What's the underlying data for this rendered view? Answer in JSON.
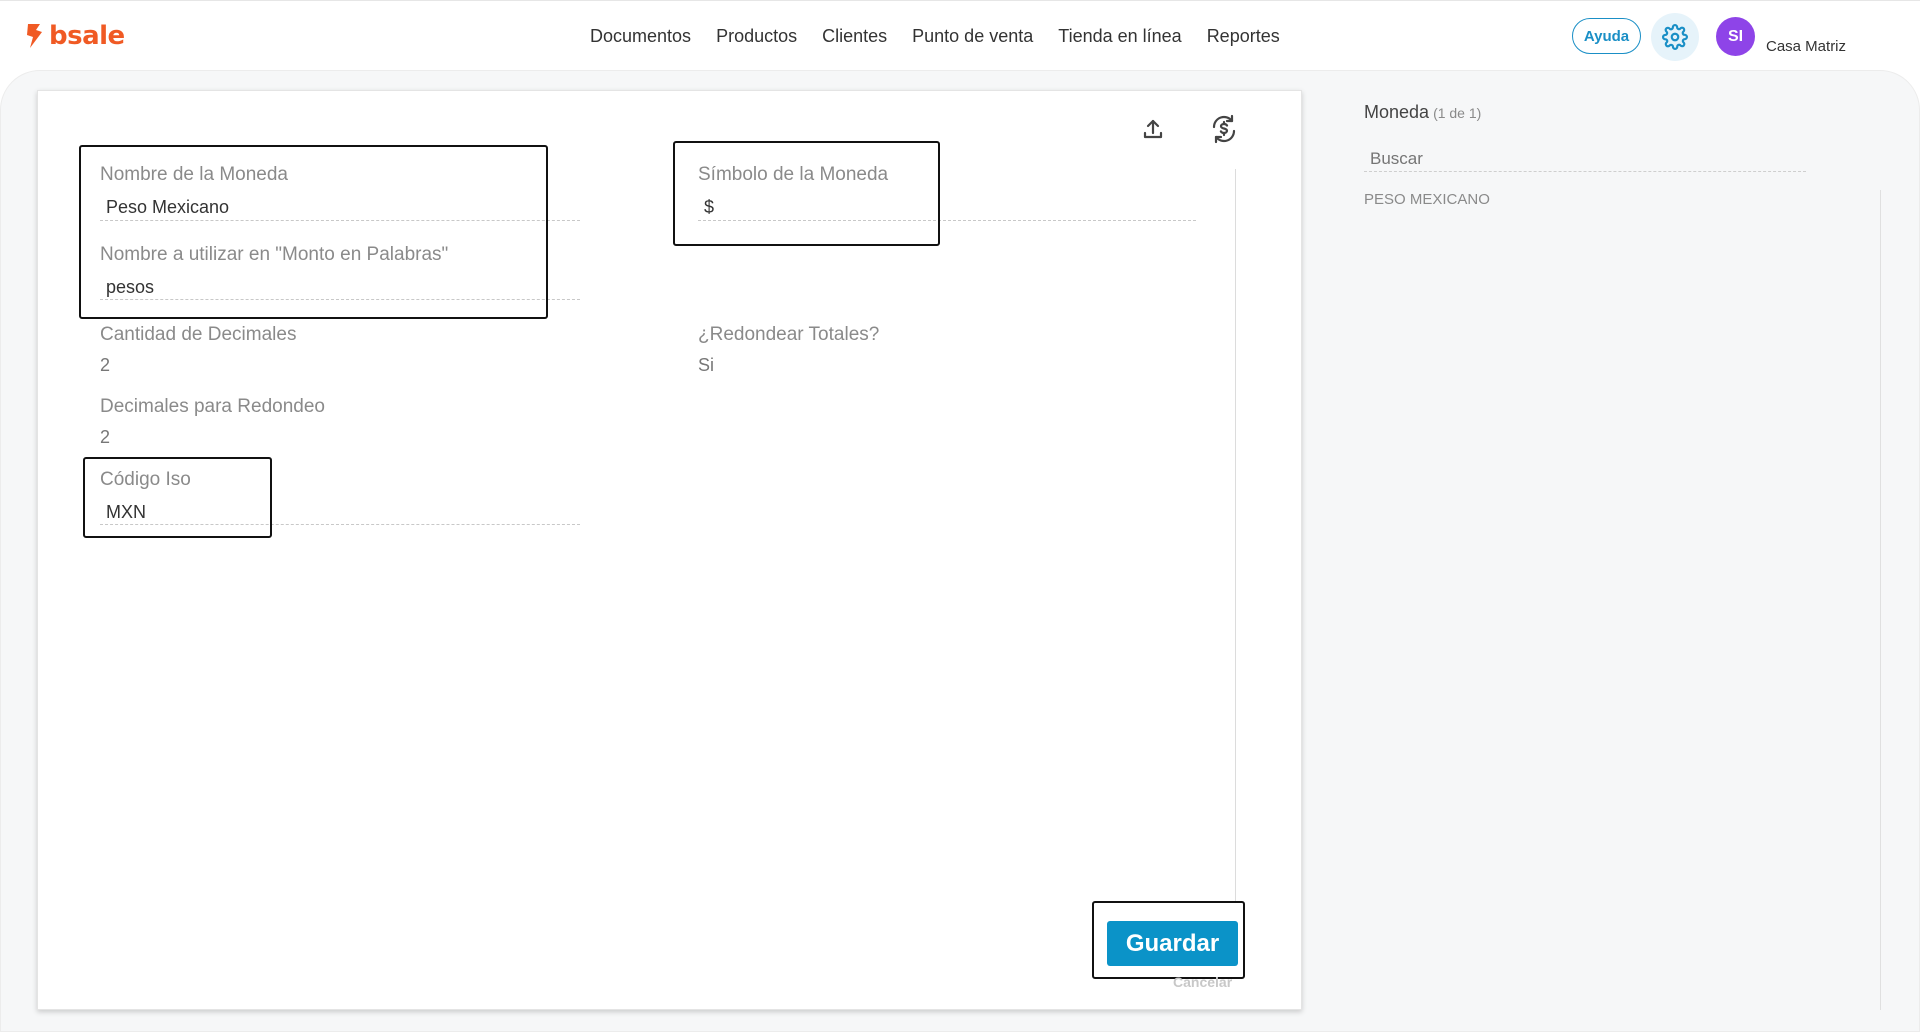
{
  "brand": {
    "name": "bsale",
    "color": "#f05a24"
  },
  "nav": {
    "items": [
      {
        "label": "Documentos"
      },
      {
        "label": "Productos"
      },
      {
        "label": "Clientes"
      },
      {
        "label": "Punto de venta"
      },
      {
        "label": "Tienda en línea"
      },
      {
        "label": "Reportes"
      }
    ]
  },
  "header": {
    "help_label": "Ayuda",
    "settings_icon": "gear-icon",
    "avatar_initials": "SI",
    "branch": "Casa Matriz"
  },
  "form": {
    "toolbar": {
      "upload_icon": "upload-icon",
      "currency_sync_icon": "currency-exchange-icon"
    },
    "currency_name": {
      "label": "Nombre de la Moneda",
      "value": "Peso Mexicano"
    },
    "currency_symbol": {
      "label": "Símbolo de la Moneda",
      "value": "$"
    },
    "words_name": {
      "label": "Nombre a utilizar en \"Monto en Palabras\"",
      "value": "pesos"
    },
    "decimals": {
      "label": "Cantidad de Decimales",
      "value": "2"
    },
    "round_totals": {
      "label": "¿Redondear Totales?",
      "value": "Si"
    },
    "round_decimals": {
      "label": "Decimales para Redondeo",
      "value": "2"
    },
    "iso_code": {
      "label": "Código Iso",
      "value": "MXN"
    },
    "save_label": "Guardar",
    "cancel_label": "Cancelar"
  },
  "sidebar": {
    "title": "Moneda",
    "count": "(1 de 1)",
    "search_placeholder": "Buscar",
    "items": [
      {
        "label": "PESO MEXICANO"
      }
    ]
  },
  "colors": {
    "primary": "#0b93c8",
    "avatar": "#8e44e8",
    "help": "#1a8fc6"
  }
}
